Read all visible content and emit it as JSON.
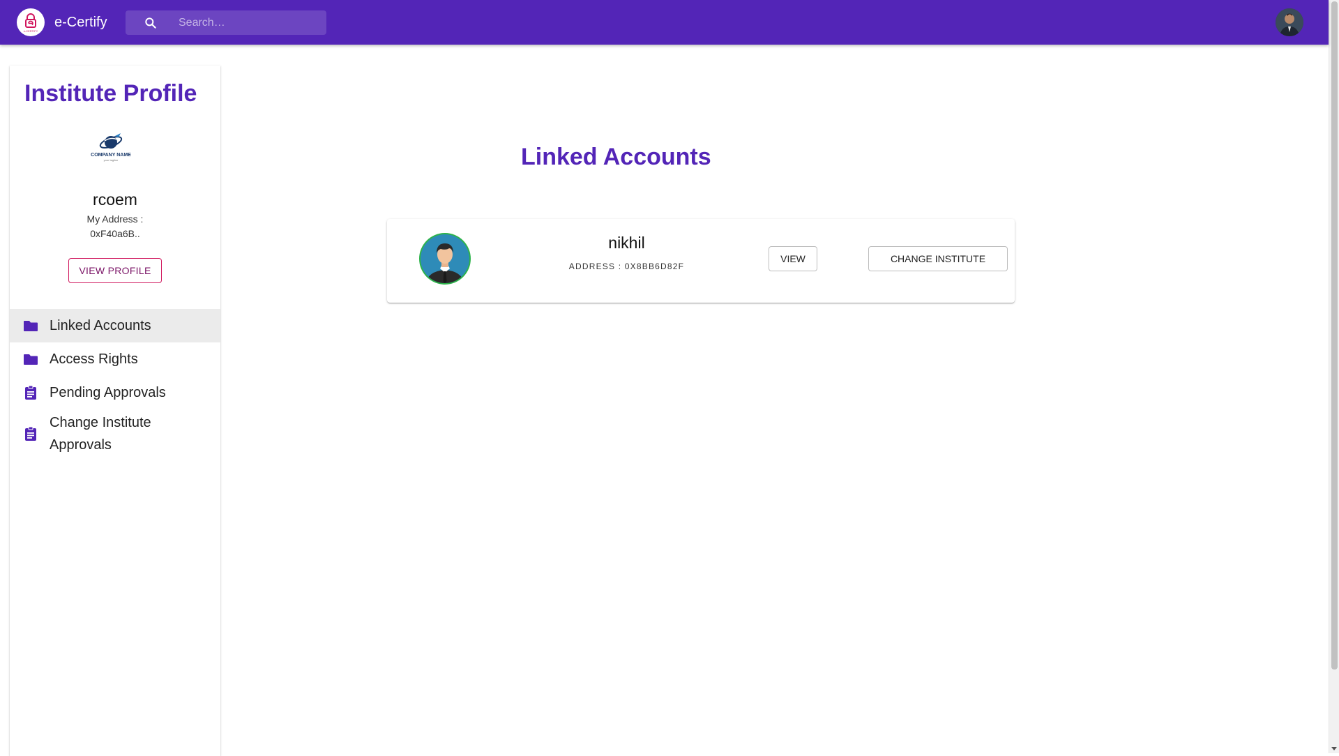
{
  "app": {
    "title": "e-Certify",
    "logo_text": "e-CERTIFY",
    "accent_color": "#5325b7",
    "secondary_color": "#d0155c"
  },
  "search": {
    "placeholder": "Search…",
    "value": ""
  },
  "sidebar": {
    "title": "Institute Profile",
    "company_logo": {
      "name": "COMPANY NAME",
      "tagline": "your tagline"
    },
    "institute_name": "rcoem",
    "address_label": "My Address :",
    "address_value": "0xF40a6B..",
    "view_profile_label": "VIEW PROFILE",
    "nav_items": [
      {
        "label": "Linked Accounts",
        "icon": "folder-icon",
        "active": true
      },
      {
        "label": "Access Rights",
        "icon": "folder-icon",
        "active": false
      },
      {
        "label": "Pending Approvals",
        "icon": "assignment-icon",
        "active": false
      },
      {
        "label": "Change Institute Approvals",
        "icon": "assignment-icon",
        "active": false
      }
    ]
  },
  "main": {
    "title": "Linked Accounts",
    "accounts": [
      {
        "name": "nikhil",
        "address": "ADDRESS : 0X8BB6D82F",
        "view_label": "VIEW",
        "change_label": "CHANGE INSTITUTE"
      }
    ]
  }
}
